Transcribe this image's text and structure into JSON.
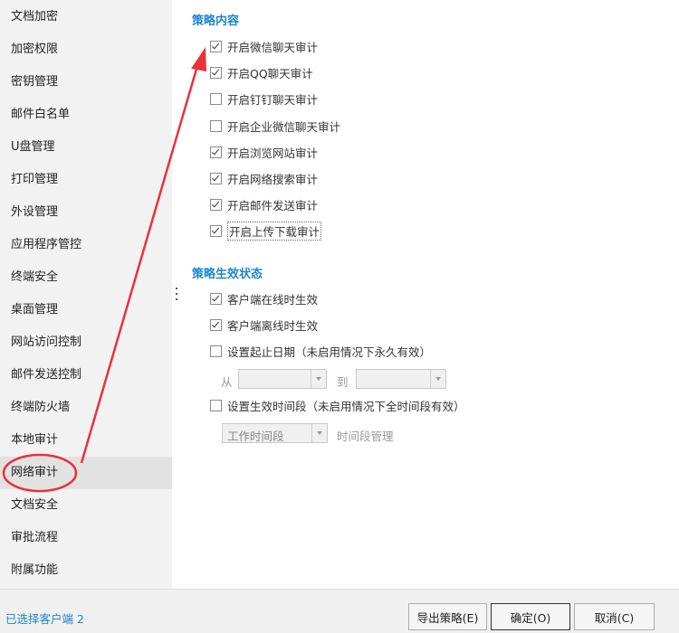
{
  "sidebar": {
    "items": [
      {
        "label": "文档加密"
      },
      {
        "label": "加密权限"
      },
      {
        "label": "密钥管理"
      },
      {
        "label": "邮件白名单"
      },
      {
        "label": "U盘管理"
      },
      {
        "label": "打印管理"
      },
      {
        "label": "外设管理"
      },
      {
        "label": "应用程序管控"
      },
      {
        "label": "终端安全"
      },
      {
        "label": "桌面管理"
      },
      {
        "label": "网站访问控制"
      },
      {
        "label": "邮件发送控制"
      },
      {
        "label": "终端防火墙"
      },
      {
        "label": "本地审计"
      },
      {
        "label": "网络审计",
        "active": true
      },
      {
        "label": "文档安全"
      },
      {
        "label": "审批流程"
      },
      {
        "label": "附属功能"
      }
    ]
  },
  "strategy": {
    "title": "策略内容",
    "options": [
      {
        "label": "开启微信聊天审计",
        "checked": true
      },
      {
        "label": "开启QQ聊天审计",
        "checked": true
      },
      {
        "label": "开启钉钉聊天审计",
        "checked": false
      },
      {
        "label": "开启企业微信聊天审计",
        "checked": false
      },
      {
        "label": "开启浏览网站审计",
        "checked": true
      },
      {
        "label": "开启网络搜索审计",
        "checked": true
      },
      {
        "label": "开启邮件发送审计",
        "checked": true
      },
      {
        "label": "开启上传下载审计",
        "checked": true
      }
    ]
  },
  "effect": {
    "title": "策略生效状态",
    "online_label": "客户端在线时生效",
    "online_checked": true,
    "offline_label": "客户端离线时生效",
    "offline_checked": true,
    "date_label": "设置起止日期（未启用情况下永久有效）",
    "date_checked": false,
    "from_label": "从",
    "to_label": "到",
    "from_value": "",
    "to_value": "",
    "time_label": "设置生效时间段（未启用情况下全时间段有效）",
    "time_checked": false,
    "time_select_value": "工作时间段",
    "time_manage_label": "时间段管理"
  },
  "footer": {
    "selected_clients": "已选择客户端 2",
    "export_button": "导出策略(E)",
    "ok_button": "确定(O)",
    "cancel_button": "取消(C)"
  },
  "colors": {
    "accent": "#1c86cf",
    "annotation": "#e8323a"
  }
}
